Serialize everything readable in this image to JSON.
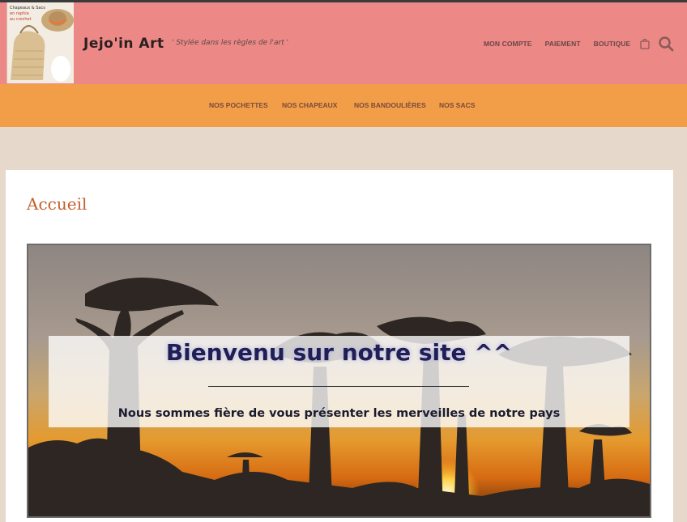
{
  "header": {
    "site_title": "Jejo'in Art",
    "tagline": "' Stylée dans les règles de l'art '",
    "logo_text": [
      "Chapeaux & Sacs",
      "en raphia",
      "au crochet"
    ],
    "top_nav": [
      "MON COMPTE",
      "PAIEMENT",
      "BOUTIQUE"
    ],
    "icons": [
      "cart-icon",
      "search-icon"
    ]
  },
  "main_nav": {
    "items": [
      "NOS POCHETTES",
      "NOS CHAPEAUX",
      "NOS BANDOULIÈRES",
      "NOS SACS"
    ]
  },
  "page": {
    "title": "Accueil"
  },
  "hero": {
    "title": "Bienvenu sur notre site ^^",
    "subtitle": "Nous sommes fière de vous présenter les merveilles de notre pays"
  },
  "colors": {
    "header_bg": "#ec8986",
    "nav_bg": "#f29e49",
    "page_bg": "#e6d8cb",
    "title_accent": "#c3602e"
  }
}
